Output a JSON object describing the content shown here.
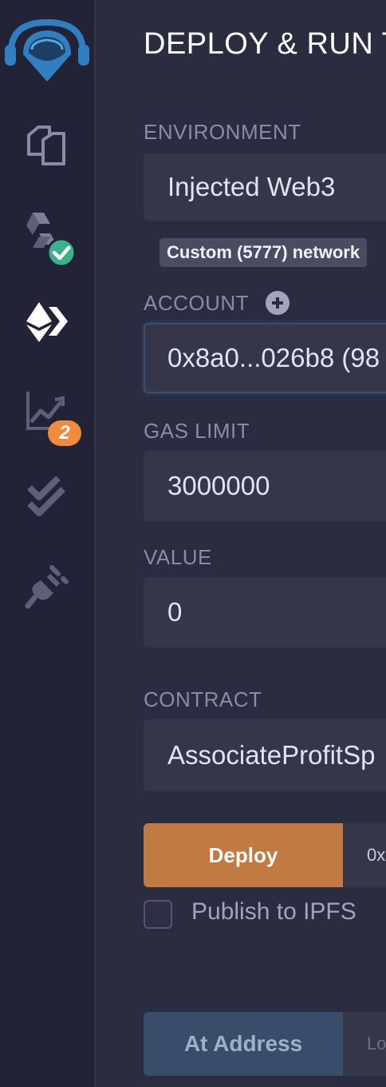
{
  "sidebar": {
    "icons": [
      {
        "name": "remix-logo-icon"
      },
      {
        "name": "file-explorer-icon"
      },
      {
        "name": "solidity-compiler-icon",
        "status": "success"
      },
      {
        "name": "deploy-run-icon",
        "active": true
      },
      {
        "name": "analysis-icon",
        "badge": "2"
      },
      {
        "name": "testing-icon"
      },
      {
        "name": "plugin-manager-icon"
      }
    ]
  },
  "panel": {
    "title": "DEPLOY & RUN T",
    "environment": {
      "label": "ENVIRONMENT",
      "value": "Injected Web3",
      "tooltip": "Custom (5777) network"
    },
    "account": {
      "label": "ACCOUNT",
      "value": "0x8a0...026b8 (98"
    },
    "gas_limit": {
      "label": "GAS LIMIT",
      "value": "3000000"
    },
    "value": {
      "label": "VALUE",
      "value": "0"
    },
    "contract": {
      "label": "CONTRACT",
      "value": "AssociateProfitSp"
    },
    "deploy": {
      "button": "Deploy",
      "input_placeholder": "0x"
    },
    "publish": {
      "label": "Publish to IPFS",
      "checked": false
    },
    "at_address": {
      "button": "At Address",
      "input_placeholder": "Lo"
    }
  },
  "colors": {
    "accent_orange": "#c17a42",
    "badge_orange": "#f08b3b",
    "success_green": "#3bb38a",
    "remix_blue": "#2f7fc1"
  }
}
